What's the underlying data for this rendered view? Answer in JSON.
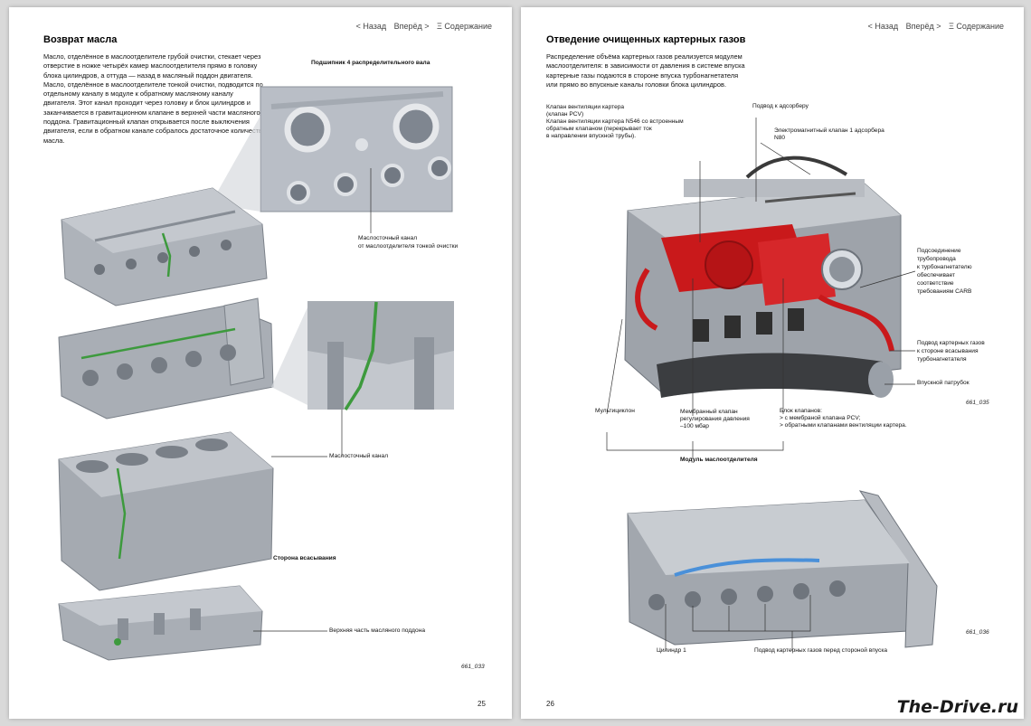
{
  "nav": {
    "back": "< Назад",
    "forward": "Вперёд >",
    "contents": "Ξ Содержание"
  },
  "left": {
    "title": "Возврат масла",
    "body": "Масло, отделённое в маслоотделителе грубой очистки, стекает через отверстие в ножке четырёх камер маслоотделителя прямо в головку блока цилиндров, а оттуда — назад в масляный поддон двигателя. Масло, отделённое в маслоотделителе тонкой очистки, подводится по отдельному каналу в модуле к обратному масляному каналу двигателя. Этот канал проходит через головку и блок цилиндров и заканчивается в гравитационном клапане в верхней части масляного поддона. Гравитационный клапан открывается после выключения двигателя, если в обратном канале собралось достаточное количество масла.",
    "labels": {
      "bearing": "Подшипник 4 распределительного вала",
      "drain_fine_1": "Маслосточный канал",
      "drain_fine_2": "от маслоотделителя тонкой очистки",
      "drain": "Маслосточный канал",
      "intake_side": "Сторона всасывания",
      "oil_pan_top": "Верхняя часть масляного поддона"
    },
    "figure": "661_033",
    "page_number": "25"
  },
  "right": {
    "title": "Отведение очищенных картерных газов",
    "body": "Распределение объёма картерных газов реализуется модулем маслоотделителя: в зависимости от давления в системе впуска картерные газы подаются в стороне впуска турбонагнетателя или прямо во впускные каналы головки блока цилиндров.",
    "labels": {
      "pcv_1": "Клапан вентиляции картера",
      "pcv_2": "(клапан PCV)",
      "pcv_3": "Клапан вентиляции картера N546 со встроенным",
      "pcv_4": "обратным клапаном (перекрывает ток",
      "pcv_5": "в направлении впускной трубы).",
      "adsorber": "Подвод к адсорберу",
      "solenoid_1": "Электромагнитный клапан 1 адсорбера",
      "solenoid_2": "N80",
      "turbo_1": "Подсоединение",
      "turbo_2": "трубопровода",
      "turbo_3": "к турбонагнетателю",
      "turbo_4": "обеспечивает",
      "turbo_5": "соответствие",
      "turbo_6": "требованиям CARB",
      "gas_turbo_1": "Подвод картерных газов",
      "gas_turbo_2": "к стороне всасывания",
      "gas_turbo_3": "турбонагнетателя",
      "intake_pipe": "Впускной патрубок",
      "multicyclone": "Мультициклон",
      "membrane_1": "Мембранный клапан",
      "membrane_2": "регулирования давления",
      "membrane_3": "–100 мбар",
      "valve_block_1": "Блок клапанов:",
      "valve_block_2": "> с мембраной клапана PCV;",
      "valve_block_3": "> обратными клапанами вентиляции картера.",
      "module": "Модуль маслоотделителя",
      "cylinder1": "Цилиндр 1",
      "gas_intake": "Подвод картерных газов перед стороной впуска"
    },
    "figure_1": "661_035",
    "figure_2": "661_036",
    "page_number": "26"
  },
  "logo": "The-Drive.ru",
  "colors": {
    "oil_channel": "#3d9a3d",
    "gas_path": "#d11a1a",
    "gas_channel": "#4a90d9"
  }
}
